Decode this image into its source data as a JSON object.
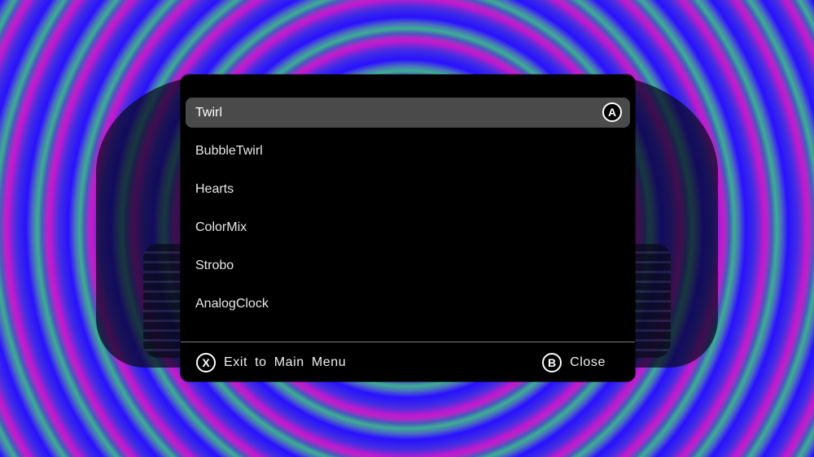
{
  "menu": {
    "items": [
      {
        "label": "Twirl",
        "selected": true
      },
      {
        "label": "BubbleTwirl",
        "selected": false
      },
      {
        "label": "Hearts",
        "selected": false
      },
      {
        "label": "ColorMix",
        "selected": false
      },
      {
        "label": "Strobo",
        "selected": false
      },
      {
        "label": "AnalogClock",
        "selected": false
      }
    ],
    "select_glyph": "A"
  },
  "footer": {
    "exit_glyph": "X",
    "exit_label": "Exit to Main Menu",
    "close_glyph": "B",
    "close_label": "Close"
  },
  "colors": {
    "panel": "#000000",
    "selected_row": "#4a4a4a",
    "text": "#ffffff",
    "divider": "#7a7a7a"
  }
}
